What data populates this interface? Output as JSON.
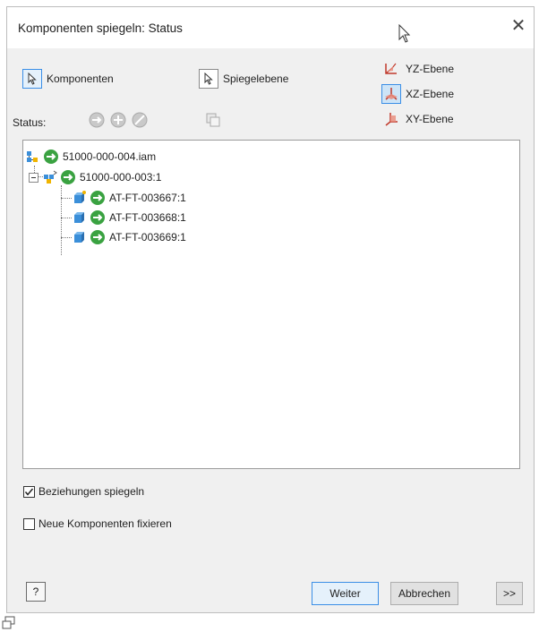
{
  "window": {
    "title": "Komponenten spiegeln: Status"
  },
  "selection": {
    "components_label": "Komponenten",
    "mirror_plane_label": "Spiegelebene"
  },
  "planes": [
    {
      "label": "YZ-Ebene"
    },
    {
      "label": "XZ-Ebene"
    },
    {
      "label": "XY-Ebene"
    }
  ],
  "status": {
    "label": "Status:"
  },
  "tree": {
    "root": "51000-000-004.iam",
    "sub": "51000-000-003:1",
    "parts": [
      "AT-FT-003667:1",
      "AT-FT-003668:1",
      "AT-FT-003669:1"
    ]
  },
  "options": {
    "mirror_relations": "Beziehungen spiegeln",
    "fix_new_components": "Neue Komponenten fixieren"
  },
  "footer": {
    "next": "Weiter",
    "cancel": "Abbrechen",
    "more": ">>",
    "help": "?"
  },
  "colors": {
    "accent": "#3a8ee6",
    "status_green": "#3aa241",
    "part_blue": "#3b8fd9"
  }
}
